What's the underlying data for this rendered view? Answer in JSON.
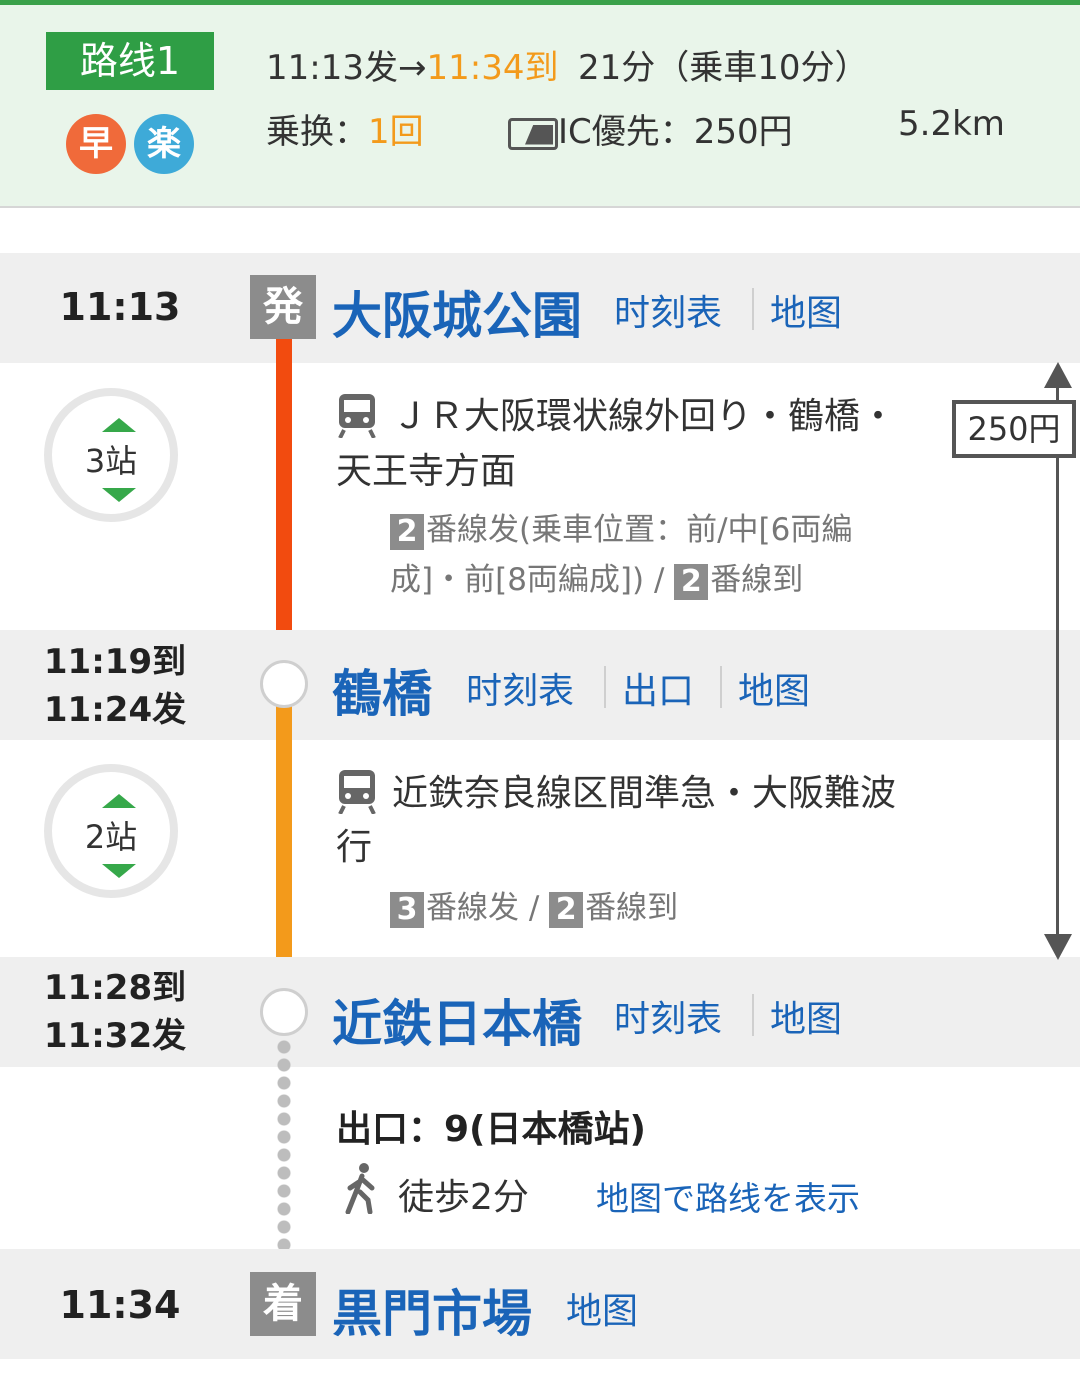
{
  "summary": {
    "route_label": "路线1",
    "fast_icon": "早",
    "easy_icon": "楽",
    "depart": "11:13发→",
    "arrive": "11:34到",
    "duration": "21分（乗車10分）",
    "transfer_label": "乗换：",
    "transfer_count": "1回",
    "ic_label": "IC優先：250円",
    "distance": "5.2km",
    "colors": {
      "accent": "#2f9e45",
      "orange": "#f39a1b",
      "link": "#1a64b8"
    }
  },
  "stations": [
    {
      "badge": "発",
      "time": "11:13",
      "name": "大阪城公園",
      "links": [
        "时刻表",
        "地图"
      ]
    },
    {
      "arrive_time": "11:19到",
      "depart_time": "11:24发",
      "name": "鶴橋",
      "links": [
        "时刻表",
        "出口",
        "地图"
      ]
    },
    {
      "arrive_time": "11:28到",
      "depart_time": "11:32发",
      "name": "近鉄日本橋",
      "links": [
        "时刻表",
        "地图"
      ]
    },
    {
      "badge": "着",
      "time": "11:34",
      "name": "黒門市場",
      "links": [
        "地图"
      ]
    }
  ],
  "segments": [
    {
      "stops": "3站",
      "line_name_1": "ＪＲ大阪環状線外回り・鶴橋・",
      "line_name_2": "天王寺方面",
      "dep_platform": "2",
      "platform_text_1": "番線发(乗車位置：前/中[6両編",
      "platform_text_2": "成]・前[8両編成]) / ",
      "arr_platform": "2",
      "arr_text": "番線到",
      "line_color": "#f24b0f"
    },
    {
      "stops": "2站",
      "line_name_1": "近鉄奈良線区間準急・大阪難波",
      "line_name_2": "行",
      "dep_platform": "3",
      "platform_text_1": "番線发 / ",
      "arr_platform": "2",
      "arr_text": "番線到",
      "line_color": "#f39a1b"
    }
  ],
  "walk": {
    "exit": "出口：9(日本橋站)",
    "walk_time": "徒歩2分",
    "map_link": "地图で路线を表示"
  },
  "fare": {
    "amount": "250円"
  }
}
